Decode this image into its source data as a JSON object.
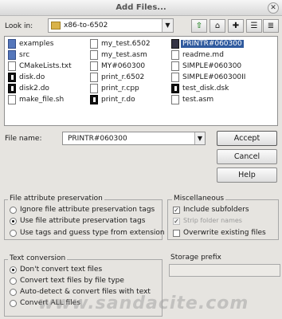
{
  "window": {
    "title": "Add Files..."
  },
  "lookin": {
    "label": "Look in:",
    "value": "x86-to-6502"
  },
  "toolbar": {
    "up_icon": "up-arrow-icon",
    "home_icon": "home-icon",
    "new_icon": "new-folder-icon",
    "list_icon": "list-view-icon",
    "detail_icon": "detail-view-icon"
  },
  "files": [
    {
      "name": "examples",
      "icon": "folder"
    },
    {
      "name": "src",
      "icon": "folder"
    },
    {
      "name": "CMakeLists.txt",
      "icon": "file"
    },
    {
      "name": "disk.do",
      "icon": "do"
    },
    {
      "name": "disk2.do",
      "icon": "do"
    },
    {
      "name": "make_file.sh",
      "icon": "file"
    },
    {
      "name": "my_test.6502",
      "icon": "file"
    },
    {
      "name": "my_test.asm",
      "icon": "file"
    },
    {
      "name": "MY#060300",
      "icon": "file"
    },
    {
      "name": "print_r.6502",
      "icon": "file"
    },
    {
      "name": "print_r.cpp",
      "icon": "file"
    },
    {
      "name": "print_r.do",
      "icon": "do"
    },
    {
      "name": "PRINTR#060300",
      "icon": "exec",
      "selected": true
    },
    {
      "name": "readme.md",
      "icon": "file"
    },
    {
      "name": "SIMPLE#060300",
      "icon": "file"
    },
    {
      "name": "SIMPLE#060300II",
      "icon": "file"
    },
    {
      "name": "test_disk.dsk",
      "icon": "do"
    },
    {
      "name": "test.asm",
      "icon": "file"
    }
  ],
  "filename": {
    "label": "File name:",
    "value": "PRINTR#060300"
  },
  "buttons": {
    "accept": "Accept",
    "cancel": "Cancel",
    "help": "Help"
  },
  "preservation": {
    "title": "File attribute preservation",
    "options": [
      {
        "label": "Ignore file attribute preservation tags",
        "checked": false
      },
      {
        "label": "Use file attribute preservation tags",
        "checked": true
      },
      {
        "label": "Use tags and guess type from extension",
        "checked": false
      }
    ]
  },
  "misc": {
    "title": "Miscellaneous",
    "options": [
      {
        "label": "Include subfolders",
        "checked": true,
        "disabled": false
      },
      {
        "label": "Strip folder names",
        "checked": true,
        "disabled": true
      },
      {
        "label": "Overwrite existing files",
        "checked": false,
        "disabled": false
      }
    ]
  },
  "conversion": {
    "title": "Text conversion",
    "options": [
      {
        "label": "Don't convert text files",
        "checked": true
      },
      {
        "label": "Convert text files by file type",
        "checked": false
      },
      {
        "label": "Auto-detect & convert files with text",
        "checked": false
      },
      {
        "label": "Convert ALL files",
        "checked": false
      }
    ]
  },
  "storage": {
    "label": "Storage prefix",
    "value": ""
  },
  "watermark": "www.sandacite.com"
}
